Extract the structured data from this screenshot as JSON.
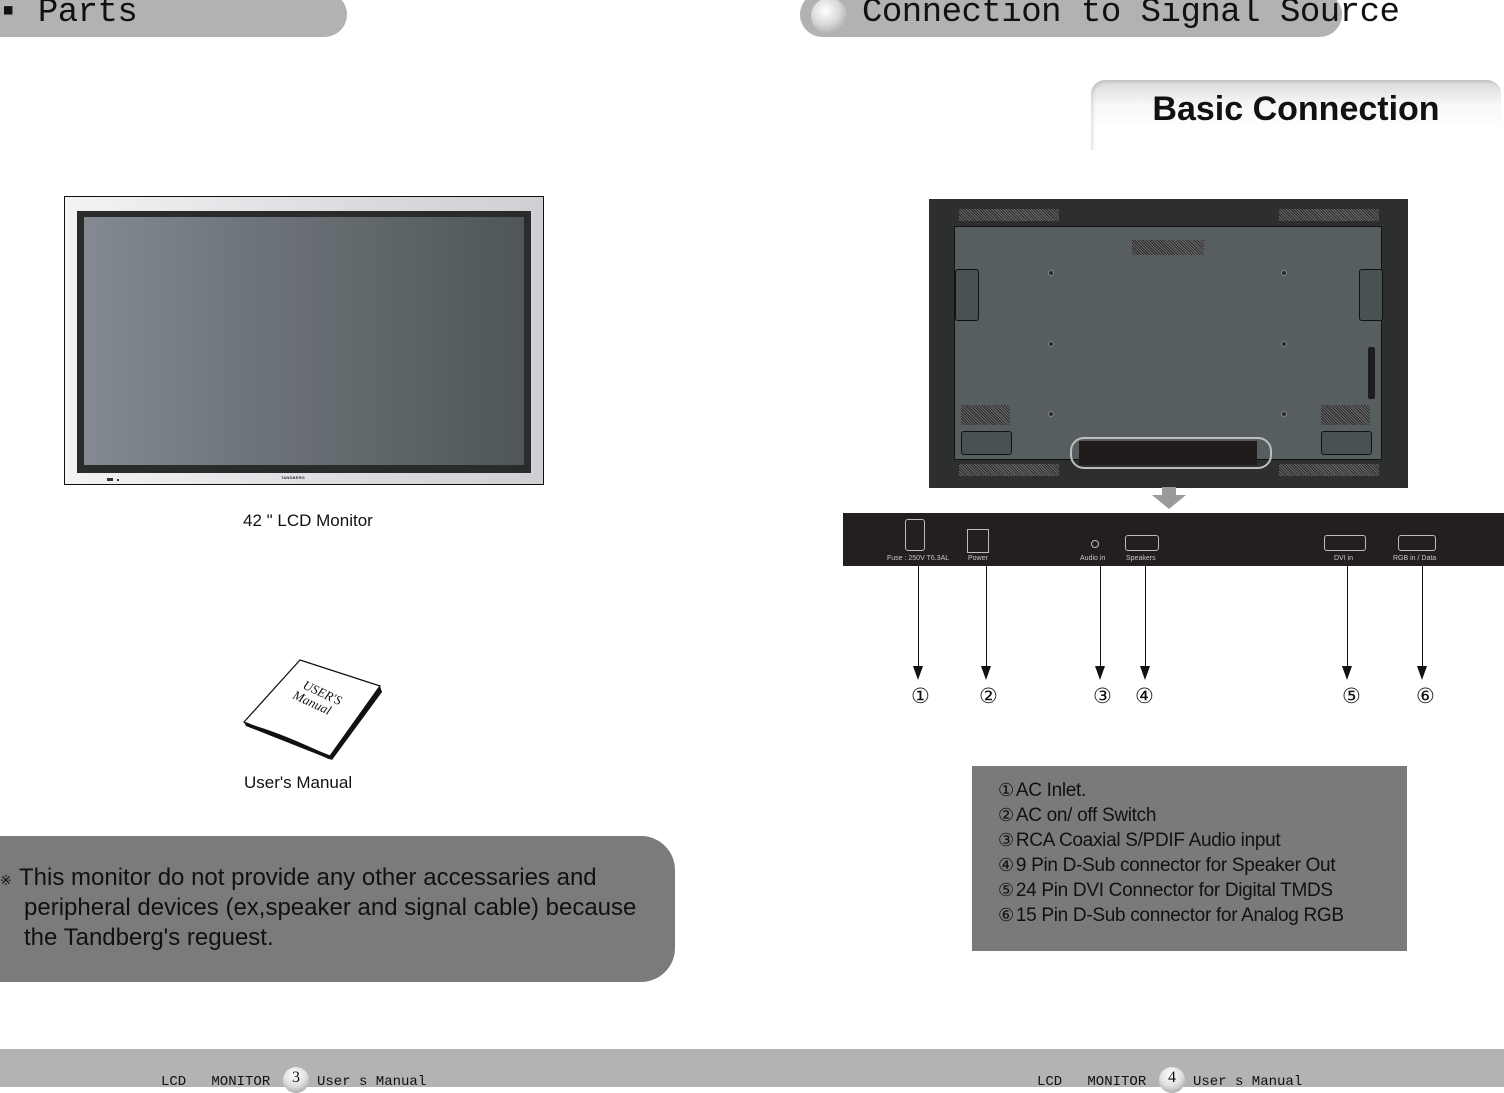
{
  "left_page": {
    "section_title": "Parts",
    "items": [
      {
        "name": "monitor",
        "caption": "42 \" LCD Monitor",
        "brand_mark": "TANDBERG"
      },
      {
        "name": "manual",
        "caption": "User's Manual",
        "cover_text_line1": "USER'S",
        "cover_text_line2": "Manual"
      }
    ],
    "note": {
      "mark": "※",
      "lines": [
        "This monitor do not provide any other accessaries and",
        "peripheral devices (ex,speaker and signal cable) because",
        "the Tandberg's reguest."
      ]
    },
    "footer": {
      "left": "LCD   MONITOR",
      "page": "3",
      "right": "User s Manual"
    }
  },
  "right_page": {
    "section_title": "Connection to Signal Source",
    "subsection_title": "Basic Connection",
    "connector_labels": [
      "Fuse : 250V T6.3AL",
      "Power",
      "Audio in",
      "Speakers",
      "DVI in",
      "RGB in / Data"
    ],
    "pointer_numbers": [
      "①",
      "②",
      "③",
      "④",
      "⑤",
      "⑥"
    ],
    "legend": [
      {
        "num": "①",
        "text": "AC Inlet."
      },
      {
        "num": "②",
        "text": "AC on/ off Switch"
      },
      {
        "num": "③",
        "text": "RCA Coaxial S/PDIF Audio input"
      },
      {
        "num": "④",
        "text": "9 Pin D-Sub connector for Speaker Out"
      },
      {
        "num": "⑤",
        "text": "24 Pin DVI Connector for Digital TMDS"
      },
      {
        "num": "⑥",
        "text": "15 Pin D-Sub connector for Analog RGB"
      }
    ],
    "footer": {
      "left": "LCD   MONITOR",
      "page": "4",
      "right": "User s Manual"
    }
  },
  "colors": {
    "header_bar": "#b2b2b2",
    "note_box": "#7b7b7b",
    "legend_box": "#7a7a7a",
    "footer_bar": "#b3b3b3"
  }
}
